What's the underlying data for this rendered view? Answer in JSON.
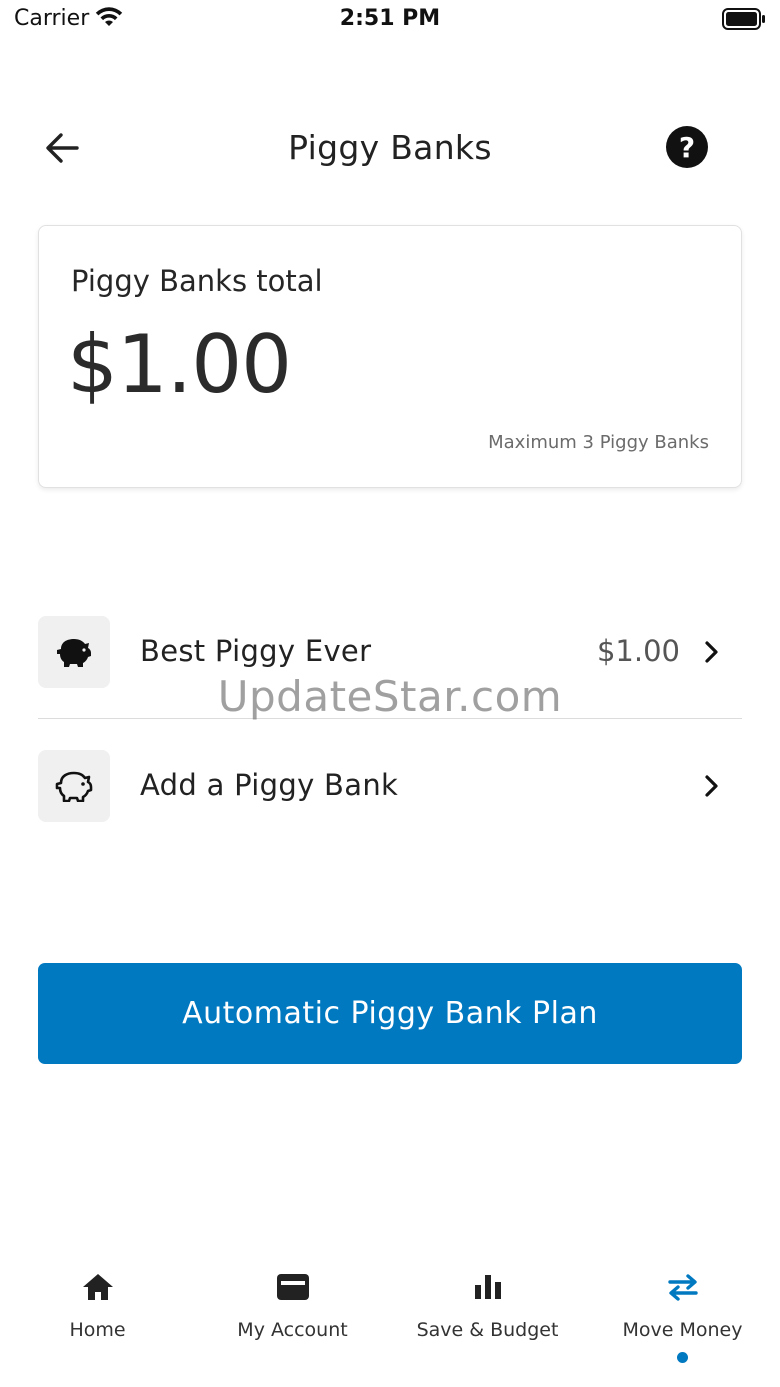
{
  "status_bar": {
    "carrier": "Carrier",
    "time": "2:51 PM"
  },
  "header": {
    "title": "Piggy Banks",
    "help_glyph": "?"
  },
  "total_card": {
    "label": "Piggy Banks total",
    "amount": "$1.00",
    "max_note": "Maximum 3 Piggy Banks"
  },
  "piggy_banks": [
    {
      "icon": "piggy-bank-filled-icon",
      "name": "Best Piggy Ever",
      "balance": "$1.00"
    }
  ],
  "add_row": {
    "icon": "piggy-bank-outline-icon",
    "label": "Add a Piggy Bank"
  },
  "watermark": "UpdateStar.com",
  "plan_button": {
    "label": "Automatic Piggy Bank Plan"
  },
  "tabs": [
    {
      "label": "Home",
      "icon": "home-icon",
      "active": false
    },
    {
      "label": "My Account",
      "icon": "card-icon",
      "active": false
    },
    {
      "label": "Save & Budget",
      "icon": "bar-chart-icon",
      "active": false
    },
    {
      "label": "Move Money",
      "icon": "transfer-arrows-icon",
      "active": true
    }
  ],
  "colors": {
    "accent": "#0079c1",
    "icon_bg": "#f0f0f0",
    "text": "#222222"
  }
}
